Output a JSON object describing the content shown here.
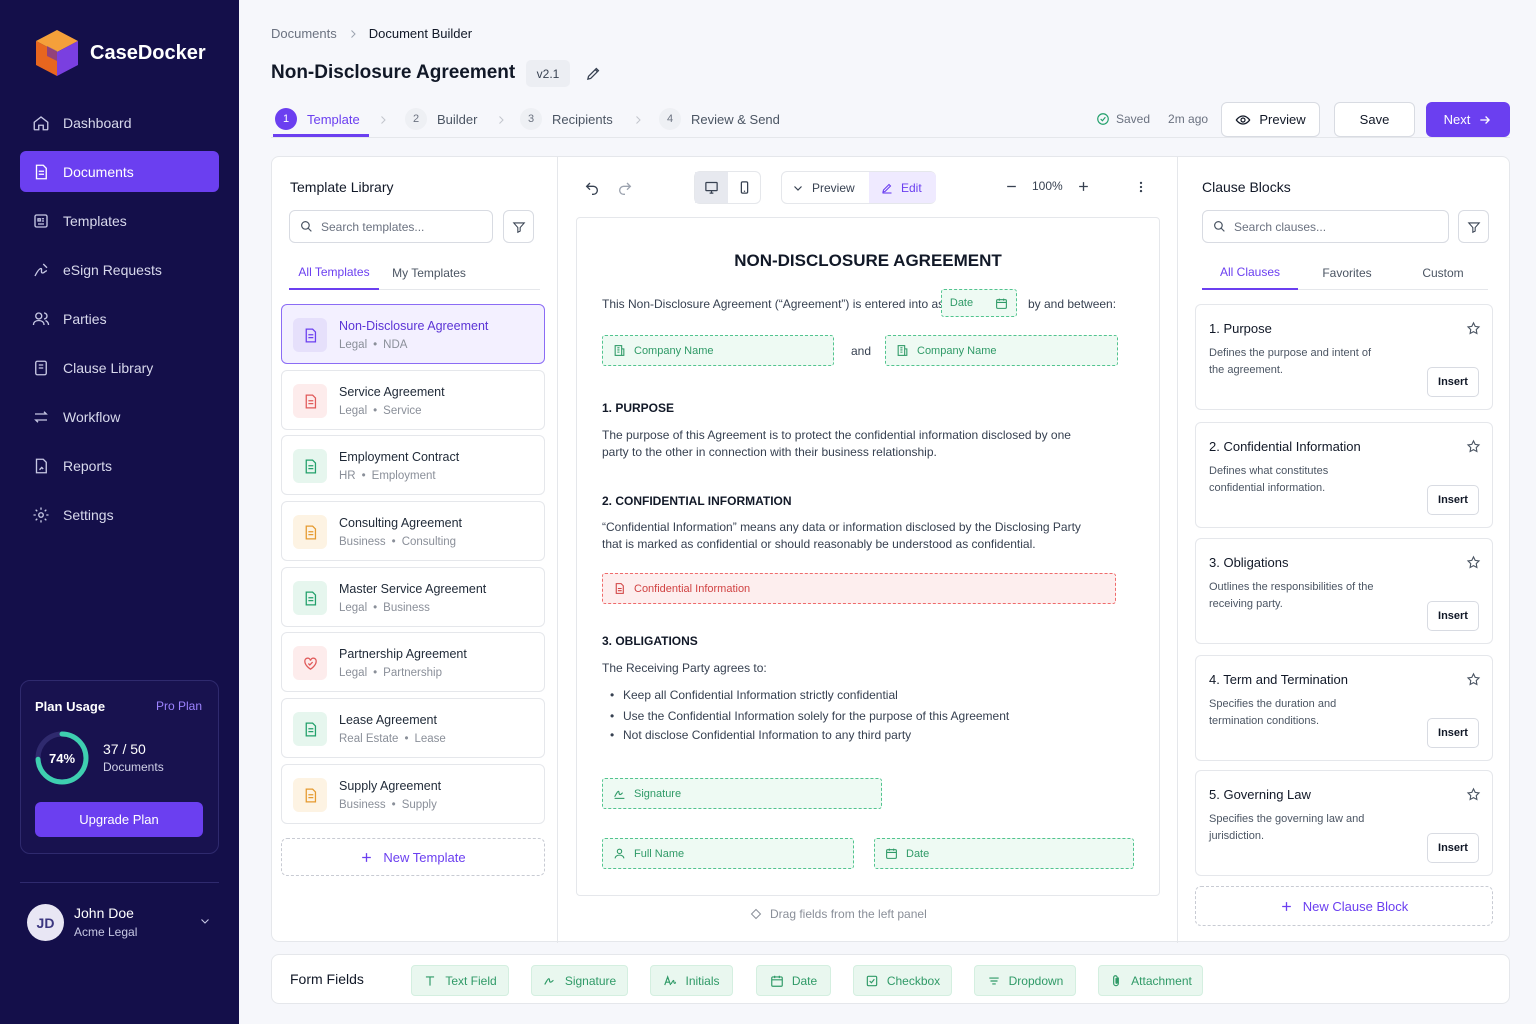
{
  "app": {
    "name": "CaseDocker"
  },
  "colors": {
    "accent": "#6b3ff0",
    "sidebar": "#140f4a",
    "field_green": "#2f9a67",
    "field_red": "#d14343"
  },
  "nav": [
    {
      "label": "Dashboard",
      "icon": "home-icon"
    },
    {
      "label": "Documents",
      "icon": "document-icon",
      "active": true
    },
    {
      "label": "Templates",
      "icon": "templates-icon"
    },
    {
      "label": "eSign Requests",
      "icon": "esign-icon"
    },
    {
      "label": "Parties",
      "icon": "users-icon"
    },
    {
      "label": "Clause Library",
      "icon": "book-icon"
    },
    {
      "label": "Workflow",
      "icon": "workflow-icon"
    },
    {
      "label": "Reports",
      "icon": "report-icon"
    },
    {
      "label": "Settings",
      "icon": "gear-icon"
    }
  ],
  "plan": {
    "title": "Plan Usage",
    "tier": "Pro Plan",
    "percent_label": "74%",
    "percent": 0.74,
    "count": "37 / 50",
    "count_label": "Documents",
    "upgrade_label": "Upgrade Plan"
  },
  "user": {
    "initials": "JD",
    "name": "John Doe",
    "org": "Acme Legal"
  },
  "breadcrumb": {
    "root": "Documents",
    "current": "Document Builder"
  },
  "document": {
    "title": "Non-Disclosure Agreement",
    "version": "v2.1"
  },
  "steps": [
    {
      "num": "1",
      "label": "Template",
      "active": true
    },
    {
      "num": "2",
      "label": "Builder"
    },
    {
      "num": "3",
      "label": "Recipients"
    },
    {
      "num": "4",
      "label": "Review & Send"
    }
  ],
  "status": {
    "saved": "Saved",
    "ago": "2m ago"
  },
  "actions": {
    "preview": "Preview",
    "save": "Save",
    "next": "Next"
  },
  "library": {
    "title": "Template Library",
    "search_placeholder": "Search templates...",
    "tabs": [
      "All Templates",
      "My Templates"
    ],
    "templates": [
      {
        "name": "Non-Disclosure Agreement",
        "cat": "Legal",
        "sub": "NDA",
        "color": "#6b3ff0",
        "bg": "#e6e0fb"
      },
      {
        "name": "Service Agreement",
        "cat": "Legal",
        "sub": "Service",
        "color": "#e05a5a",
        "bg": "#fdecec"
      },
      {
        "name": "Employment Contract",
        "cat": "HR",
        "sub": "Employment",
        "color": "#22a06b",
        "bg": "#e6f6ee"
      },
      {
        "name": "Consulting Agreement",
        "cat": "Business",
        "sub": "Consulting",
        "color": "#e59a2f",
        "bg": "#fdf3e3"
      },
      {
        "name": "Master Service Agreement",
        "cat": "Legal",
        "sub": "Business",
        "color": "#22a06b",
        "bg": "#e6f6ee"
      },
      {
        "name": "Partnership Agreement",
        "cat": "Legal",
        "sub": "Partnership",
        "color": "#e05a5a",
        "bg": "#fdecec"
      },
      {
        "name": "Lease Agreement",
        "cat": "Real Estate",
        "sub": "Lease",
        "color": "#22a06b",
        "bg": "#e6f6ee"
      },
      {
        "name": "Supply Agreement",
        "cat": "Business",
        "sub": "Supply",
        "color": "#e59a2f",
        "bg": "#fdf3e3"
      }
    ],
    "new_label": "New Template"
  },
  "editor": {
    "mode_preview": "Preview",
    "mode_edit": "Edit",
    "zoom": "100%",
    "hint": "Drag fields from the left panel"
  },
  "paper": {
    "title": "NON-DISCLOSURE AGREEMENT",
    "intro_a": "This Non-Disclosure Agreement (“Agreement”) is entered into as of",
    "intro_b": "by and between:",
    "and": "and",
    "f_date": "Date",
    "f_company1": "Company Name",
    "f_company2": "Company Name",
    "s1_h": "1. PURPOSE",
    "s1_l1": "The purpose of this Agreement is to protect the confidential information disclosed by one",
    "s1_l2": "party to the other in connection with their business relationship.",
    "s2_h": "2. CONFIDENTIAL INFORMATION",
    "s2_l1": "“Confidential Information” means any data or information disclosed by the Disclosing Party",
    "s2_l2": "that is marked as confidential or should reasonably be understood as confidential.",
    "f_conf": "Confidential Information",
    "s3_h": "3. OBLIGATIONS",
    "s3_intro": "The Receiving Party agrees to:",
    "bullets": [
      "Keep all Confidential Information strictly confidential",
      "Use the Confidential Information solely for the purpose of this Agreement",
      "Not disclose Confidential Information to any third party"
    ],
    "f_signature": "Signature",
    "f_fullname": "Full Name",
    "f_date2": "Date"
  },
  "clauses": {
    "title": "Clause Blocks",
    "search_placeholder": "Search clauses...",
    "tabs": [
      "All Clauses",
      "Favorites",
      "Custom"
    ],
    "items": [
      {
        "name": "1. Purpose",
        "desc": "Defines the purpose and intent of the agreement."
      },
      {
        "name": "2. Confidential Information",
        "desc": "Defines what constitutes confidential information."
      },
      {
        "name": "3. Obligations",
        "desc": "Outlines the responsibilities of the receiving party."
      },
      {
        "name": "4. Term and Termination",
        "desc": "Specifies the duration and termination conditions."
      },
      {
        "name": "5. Governing Law",
        "desc": "Specifies the governing law and jurisdiction."
      }
    ],
    "insert_label": "Insert",
    "new_label": "New Clause Block"
  },
  "form_fields": {
    "title": "Form Fields",
    "items": [
      {
        "label": "Text Field",
        "icon": "text-icon"
      },
      {
        "label": "Signature",
        "icon": "signature-icon"
      },
      {
        "label": "Initials",
        "icon": "initials-icon"
      },
      {
        "label": "Date",
        "icon": "calendar-icon"
      },
      {
        "label": "Checkbox",
        "icon": "checkbox-icon"
      },
      {
        "label": "Dropdown",
        "icon": "dropdown-icon"
      },
      {
        "label": "Attachment",
        "icon": "paperclip-icon"
      }
    ]
  }
}
